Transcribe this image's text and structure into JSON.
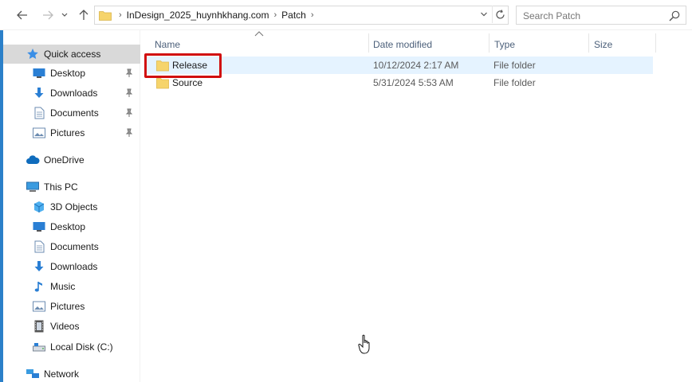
{
  "address_bar": {
    "breadcrumbs": [
      "InDesign_2025_huynhkhang.com",
      "Patch"
    ],
    "search_placeholder": "Search Patch"
  },
  "sidebar": {
    "items": [
      {
        "label": "Quick access",
        "icon": "star-icon",
        "selected": true,
        "pinned": false
      },
      {
        "label": "Desktop",
        "icon": "desktop-icon",
        "pinned": true
      },
      {
        "label": "Downloads",
        "icon": "download-arrow-icon",
        "pinned": true
      },
      {
        "label": "Documents",
        "icon": "document-icon",
        "pinned": true
      },
      {
        "label": "Pictures",
        "icon": "pictures-icon",
        "pinned": true
      },
      {
        "label": "OneDrive",
        "icon": "cloud-icon"
      },
      {
        "label": "This PC",
        "icon": "computer-icon"
      },
      {
        "label": "3D Objects",
        "icon": "cube-icon"
      },
      {
        "label": "Desktop",
        "icon": "desktop-icon"
      },
      {
        "label": "Documents",
        "icon": "document-icon"
      },
      {
        "label": "Downloads",
        "icon": "download-arrow-icon"
      },
      {
        "label": "Music",
        "icon": "music-note-icon"
      },
      {
        "label": "Pictures",
        "icon": "pictures-icon"
      },
      {
        "label": "Videos",
        "icon": "film-icon"
      },
      {
        "label": "Local Disk (C:)",
        "icon": "drive-icon"
      },
      {
        "label": "Network",
        "icon": "network-icon"
      }
    ]
  },
  "file_list": {
    "columns": {
      "name": "Name",
      "date": "Date modified",
      "type": "Type",
      "size": "Size"
    },
    "rows": [
      {
        "name": "Release",
        "date": "10/12/2024 2:17 AM",
        "type": "File folder",
        "selected": true
      },
      {
        "name": "Source",
        "date": "5/31/2024 5:53 AM",
        "type": "File folder"
      }
    ]
  },
  "colors": {
    "accent": "#2b80c9",
    "selection": "#e5f3ff",
    "highlight_box": "#d10f0f",
    "folder": "#f6d46b"
  }
}
